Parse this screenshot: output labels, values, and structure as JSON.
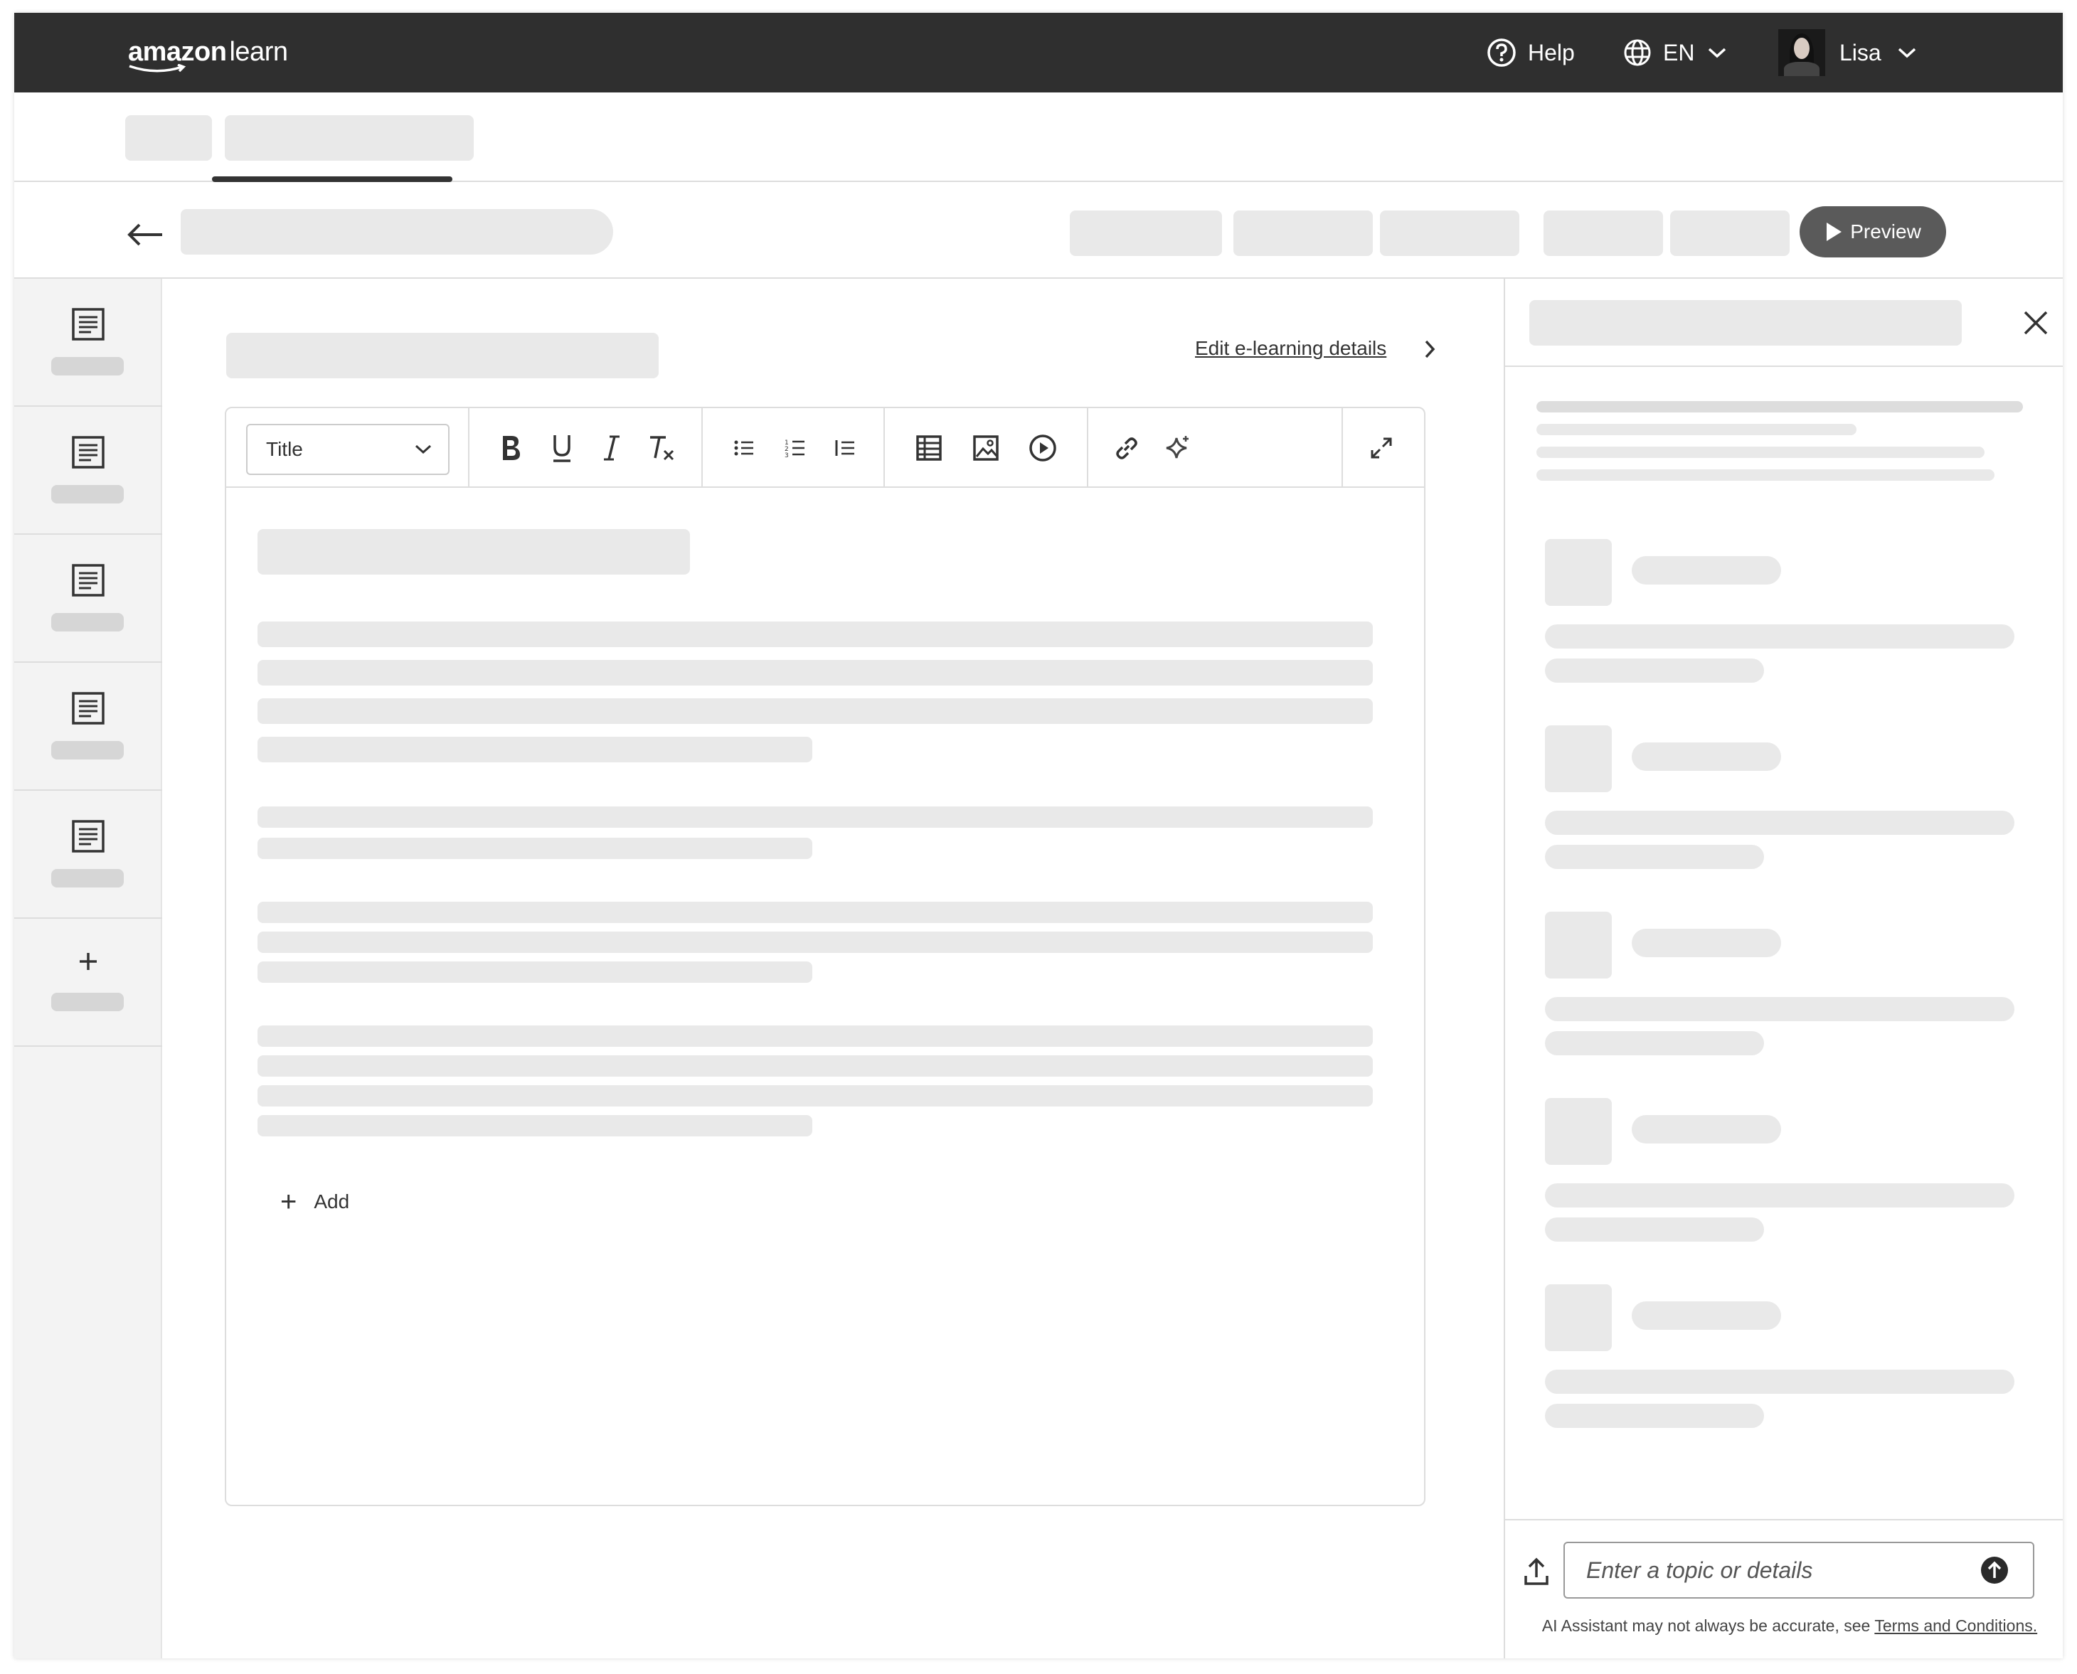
{
  "header": {
    "logo_brand": "amazon",
    "logo_product": "learn",
    "help_label": "Help",
    "language_label": "EN",
    "user_name": "Lisa"
  },
  "toolbar_header": {
    "preview_label": "Preview"
  },
  "editor": {
    "edit_details_link": "Edit e-learning details",
    "text_style_value": "Title",
    "format_buttons": [
      "bold-icon",
      "underline-icon",
      "italic-icon",
      "clear-format-icon"
    ],
    "list_buttons": [
      "bulleted-list-icon",
      "numbered-list-icon",
      "blockquote-icon"
    ],
    "insert_buttons": [
      "table-icon",
      "image-icon",
      "video-icon"
    ],
    "extra_buttons": [
      "link-icon",
      "ai-sparkle-icon"
    ],
    "add_label": "Add"
  },
  "left_rail": {
    "page_icons": [
      "document-icon",
      "document-icon",
      "document-icon",
      "document-icon",
      "document-icon"
    ],
    "add_icon": "plus-icon"
  },
  "assistant": {
    "input_placeholder": "Enter a topic or details",
    "disclaimer_text": "AI Assistant may not always be accurate, see ",
    "terms_link": "Terms and Conditions."
  },
  "colors": {
    "topbar": "#2f2f2f",
    "skeleton": "#e9e9e9",
    "preview_button": "#5a5a5a",
    "rail": "#f3f3f3"
  }
}
